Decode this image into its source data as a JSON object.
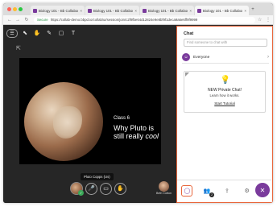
{
  "browser": {
    "tabs": [
      {
        "label": "Biology 101 - Bb Collabora",
        "close": "×"
      },
      {
        "label": "Biology 101 - Bb Collabora",
        "close": "×"
      },
      {
        "label": "Biology 101 - Bb Collabora",
        "close": "×"
      },
      {
        "label": "Biology 101 - Bb Collabora",
        "close": "×"
      }
    ],
    "new_tab": "+",
    "secure_label": "Secure",
    "url": "https://collab-demo.bbpd.io/collab/ui/session/join/c2f9fbe64d12824e9e8bf9f1deca9a6e6ff9f9999",
    "back": "←",
    "forward": "→",
    "reload": "↻",
    "star": "☆",
    "menu": "⋮"
  },
  "toolbar": {
    "menu_icon": "☰",
    "select_icon": "⬉",
    "hand_icon": "✋",
    "pen_icon": "✎",
    "shape_icon": "▢",
    "text_icon": "T",
    "share_icon": "⇱"
  },
  "slide": {
    "class_label": "Class 6",
    "title_main": "Why Pluto is still really ",
    "title_em": "cool"
  },
  "session": {
    "tooltip": "Pluto Copps  (Us)",
    "presenter_name": "Beth Cotton",
    "status_icon": "✓",
    "mic_icon": "🎤",
    "camera_icon": "▭",
    "hand_raise_icon": "✋"
  },
  "chat": {
    "title": "Chat",
    "search_placeholder": "Find someone to chat with",
    "everyone_label": "Everyone",
    "everyone_icon": "☺",
    "chevron": "›",
    "card_title": "NEW Private Chat!",
    "card_subtitle": "Learn how it works.",
    "card_link": "Start Tutorial",
    "lightbulb_icon": "💡"
  },
  "panel_tabs": {
    "chat_icon": "◯",
    "attendees_icon": "👥",
    "attendee_count": "2",
    "share_icon": "⇪",
    "settings_icon": "⚙",
    "close_icon": "✕"
  },
  "colors": {
    "accent": "#7a3b9c",
    "highlight": "#e8653a",
    "stage_bg": "#262626"
  }
}
